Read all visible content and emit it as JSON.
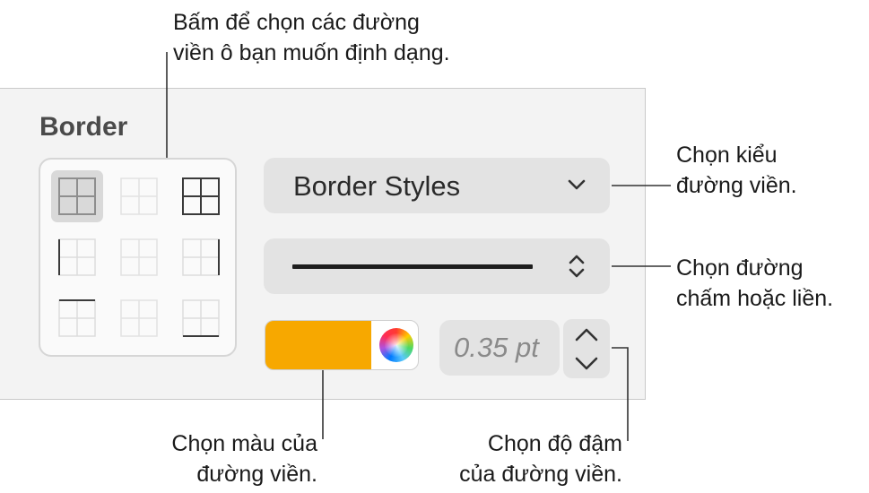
{
  "callouts": {
    "top": [
      "Bấm để chọn các đường",
      "viền ô bạn muốn định dạng."
    ],
    "style": [
      "Chọn kiểu",
      "đường viền."
    ],
    "line": [
      "Chọn đường",
      "chấm hoặc liền."
    ],
    "color": [
      "Chọn màu của",
      "đường viền."
    ],
    "weight": [
      "Chọn độ đậm",
      "của đường viền."
    ]
  },
  "panel": {
    "title": "Border",
    "border_styles_label": "Border Styles",
    "weight_value": "0.35 pt",
    "border_color": "#f7a800",
    "selected_cell": "all-borders-grid"
  },
  "border_grid": [
    "all-borders",
    "inner-borders",
    "outer-borders",
    "left-border",
    "inside-vertical",
    "right-border",
    "top-border",
    "inside-horizontal",
    "bottom-border"
  ],
  "icons": {
    "dropdown": "chevron-down-icon",
    "line_style": "up-down-chevron-icon",
    "color_wheel": "color-wheel-icon",
    "stepper_up": "chevron-up-icon",
    "stepper_down": "chevron-down-icon"
  }
}
